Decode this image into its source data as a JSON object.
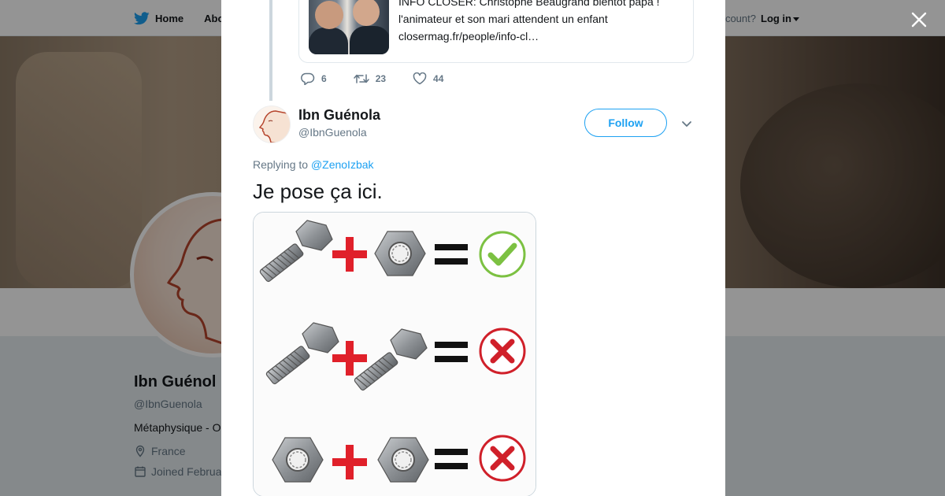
{
  "topnav": {
    "home_label": "Home",
    "about_label": "Abo",
    "account_prompt": "ccount?",
    "login_label": "Log in"
  },
  "profile": {
    "name": "Ibn Guénol",
    "handle": "@IbnGuenola",
    "bio": "Métaphysique - O",
    "location": "France",
    "joined": "Joined Februa"
  },
  "quoted_card": {
    "line1": "INFO CLOSER: Christophe Beaugrand bientôt papa !",
    "line2": "l'animateur et son mari attendent un enfant",
    "line3": "closermag.fr/people/info-cl…"
  },
  "previous_tweet_actions": {
    "replies": "6",
    "retweets": "23",
    "likes": "44"
  },
  "tweet": {
    "author_name": "Ibn Guénola",
    "author_handle": "@IbnGuenola",
    "follow_label": "Follow",
    "replying_prefix": "Replying to",
    "replying_to": "@ZenoIzbak",
    "text": "Je pose ça ici."
  },
  "colors": {
    "accent": "#1da1f2",
    "plus": "#e0202a",
    "check": "#7cc142",
    "cross": "#d0202a"
  },
  "icons": [
    "twitter-bird-icon",
    "close-icon",
    "reply-icon",
    "retweet-icon",
    "like-icon",
    "chevron-down-icon",
    "location-icon",
    "calendar-icon"
  ]
}
